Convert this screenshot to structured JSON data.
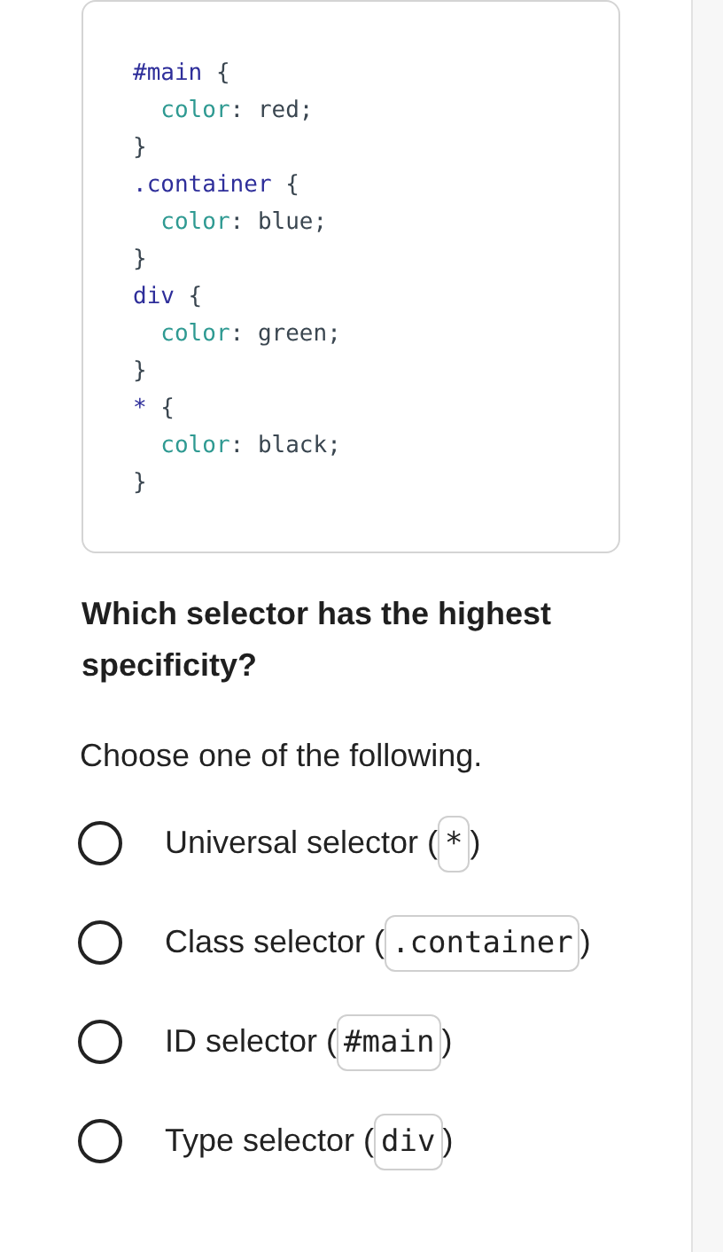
{
  "code_block": {
    "lines": [
      [
        {
          "text": "#main",
          "kind": "selector"
        },
        {
          "text": " {",
          "kind": "punct"
        }
      ],
      [
        {
          "text": "  color",
          "kind": "property"
        },
        {
          "text": ": ",
          "kind": "punct"
        },
        {
          "text": "red;",
          "kind": "value"
        }
      ],
      [
        {
          "text": "}",
          "kind": "punct"
        }
      ],
      [
        {
          "text": ".container",
          "kind": "selector"
        },
        {
          "text": " {",
          "kind": "punct"
        }
      ],
      [
        {
          "text": "  color",
          "kind": "property"
        },
        {
          "text": ": ",
          "kind": "punct"
        },
        {
          "text": "blue;",
          "kind": "value"
        }
      ],
      [
        {
          "text": "}",
          "kind": "punct"
        }
      ],
      [
        {
          "text": "div",
          "kind": "selector"
        },
        {
          "text": " {",
          "kind": "punct"
        }
      ],
      [
        {
          "text": "  color",
          "kind": "property"
        },
        {
          "text": ": ",
          "kind": "punct"
        },
        {
          "text": "green;",
          "kind": "value"
        }
      ],
      [
        {
          "text": "}",
          "kind": "punct"
        }
      ],
      [
        {
          "text": "*",
          "kind": "selector"
        },
        {
          "text": " {",
          "kind": "punct"
        }
      ],
      [
        {
          "text": "  color",
          "kind": "property"
        },
        {
          "text": ": ",
          "kind": "punct"
        },
        {
          "text": "black;",
          "kind": "value"
        }
      ],
      [
        {
          "text": "}",
          "kind": "punct"
        }
      ]
    ]
  },
  "question": "Which selector has the highest specificity?",
  "instruction": "Choose one of the following.",
  "options": [
    {
      "label": "Universal selector (",
      "code": "*",
      "after": ")",
      "selected": false
    },
    {
      "label": "Class selector (",
      "code": ".container",
      "after": ")",
      "selected": false
    },
    {
      "label": "ID selector (",
      "code": "#main",
      "after": ")",
      "selected": false
    },
    {
      "label": "Type selector (",
      "code": "div",
      "after": ")",
      "selected": false
    }
  ]
}
